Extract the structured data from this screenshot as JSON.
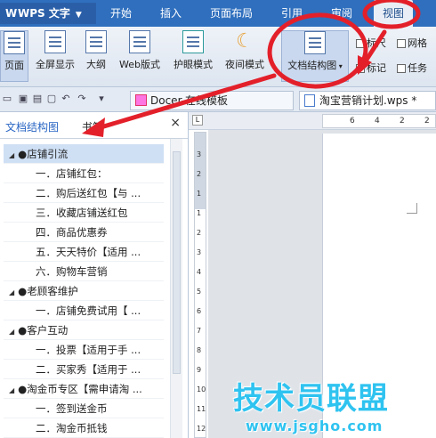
{
  "menubar": {
    "logo": "WPS 文字",
    "items": [
      "开始",
      "插入",
      "页面布局",
      "引用",
      "审阅",
      "视图"
    ]
  },
  "ribbon": {
    "buttons": [
      "页面",
      "全屏显示",
      "大纲",
      "Web版式",
      "护眼模式",
      "夜间模式",
      "文档结构图"
    ],
    "checkbox1": "标尺",
    "checkbox2": "网格",
    "checkbox3": "标记",
    "checkbox4": "任务"
  },
  "doc_tabs": {
    "tab1": "Docer-在线模板",
    "tab2": "淘宝营销计划.wps *"
  },
  "pane": {
    "tab_active": "文档结构图",
    "tab_other": "书签",
    "close": "×"
  },
  "tree": [
    {
      "level": 1,
      "text": "●店铺引流",
      "selected": true
    },
    {
      "level": 2,
      "text": "一．店铺红包："
    },
    {
      "level": 2,
      "text": "二．购后送红包【与 ..."
    },
    {
      "level": 2,
      "text": "三．收藏店铺送红包"
    },
    {
      "level": 2,
      "text": "四．商品优惠券"
    },
    {
      "level": 2,
      "text": "五．天天特价【适用 ..."
    },
    {
      "level": 2,
      "text": "六．购物车营销"
    },
    {
      "level": 1,
      "text": "●老顾客维护"
    },
    {
      "level": 2,
      "text": "一．店铺免费试用【 ..."
    },
    {
      "level": 1,
      "text": "●客户互动"
    },
    {
      "level": 2,
      "text": "一．投票【适用于手 ..."
    },
    {
      "level": 2,
      "text": "二．买家秀【适用于 ..."
    },
    {
      "level": 1,
      "text": "●淘金币专区【需申请淘 ..."
    },
    {
      "level": 2,
      "text": "一．签到送金币"
    },
    {
      "level": 2,
      "text": "二．淘金币抵钱"
    }
  ],
  "ruler": {
    "h": [
      "6",
      "4",
      "2",
      "2"
    ],
    "v": [
      "3",
      "2",
      "1",
      "1",
      "2",
      "3",
      "4",
      "5",
      "6",
      "7",
      "8",
      "9",
      "10",
      "11",
      "12"
    ],
    "corner": "L"
  },
  "watermark": {
    "title": "技术员联盟",
    "url": "www.jsgho.com"
  },
  "colors": {
    "menubar": "#2f6fbe",
    "annotation_red": "#e3202a",
    "watermark": "#2fc3f0"
  }
}
